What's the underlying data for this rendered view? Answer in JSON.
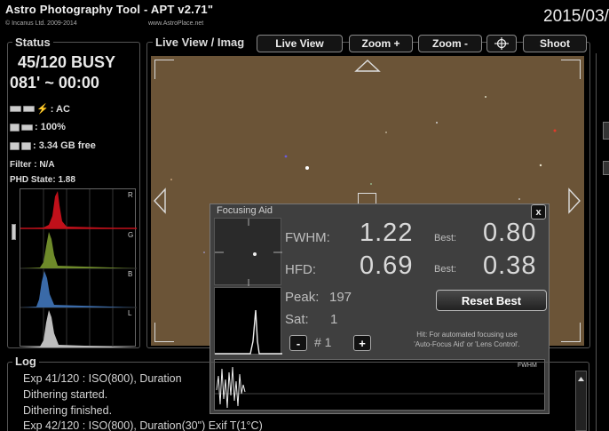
{
  "header": {
    "app_title": "Astro Photography Tool - APT v2.71\"",
    "copyright": "© Incanus Ltd. 2009-2014",
    "website": "www.AstroPlace.net",
    "date": "2015/03/"
  },
  "status": {
    "title": "Status",
    "counter": "45/120 BUSY",
    "timer": "081' ~ 00:00",
    "power": ": AC",
    "battery": ": 100%",
    "storage": ": 3.34 GB free",
    "filter": "Filter : N/A",
    "phd": "PHD State: 1.88",
    "histogram_channels": [
      "R",
      "G",
      "B",
      "L"
    ]
  },
  "live_view": {
    "title": "Live View / Imag",
    "toolbar": {
      "live_view": "Live View",
      "zoom_in": "Zoom +",
      "zoom_out": "Zoom -",
      "shoot": "Shoot"
    }
  },
  "focusing_aid": {
    "title": "Focusing Aid",
    "close": "x",
    "fwhm_label": "FWHM:",
    "fwhm_value": "1.22",
    "fwhm_best_label": "Best:",
    "fwhm_best": "0.80",
    "hfd_label": "HFD:",
    "hfd_value": "0.69",
    "hfd_best_label": "Best:",
    "hfd_best": "0.38",
    "peak_label": "Peak:",
    "peak_value": "197",
    "sat_label": "Sat:",
    "sat_value": "1",
    "reset_best": "Reset Best",
    "minus": "-",
    "star_index": "# 1",
    "plus": "+",
    "hint_line1": "Hit: For automated focusing use",
    "hint_line2": "'Auto-Focus Aid' or 'Lens Control'.",
    "graph_label": "FWHM"
  },
  "log": {
    "title": "Log",
    "lines": [
      "Exp 41/120 : ISO(800), Duration",
      "Dithering started.",
      "Dithering finished.",
      "Exp 42/120 : ISO(800), Duration(30\") Exif T(1°C)"
    ]
  },
  "colors": {
    "sky": "#6b5437",
    "red_channel": "#c0101a",
    "green_channel": "#6e8a2a",
    "blue_channel": "#3a6aa8",
    "lum_channel": "#bdbdbd"
  }
}
